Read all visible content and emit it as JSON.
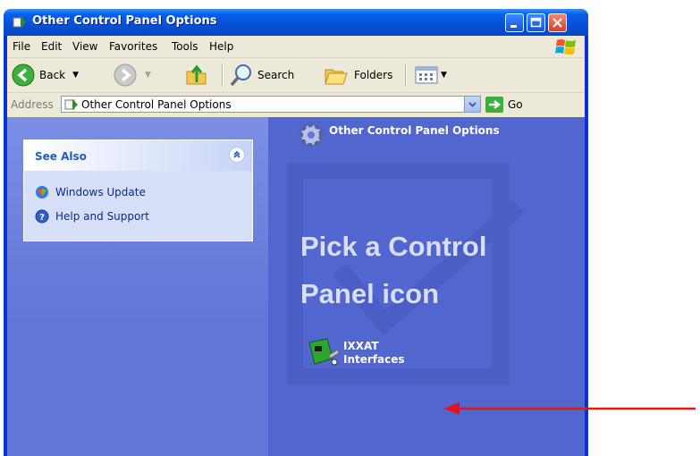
{
  "window": {
    "title": "Other Control Panel Options"
  },
  "menu": {
    "items": [
      "File",
      "Edit",
      "View",
      "Favorites",
      "Tools",
      "Help"
    ]
  },
  "toolbar": {
    "back": "Back",
    "search": "Search",
    "folders": "Folders"
  },
  "address": {
    "label": "Address",
    "value": "Other Control Panel Options",
    "go": "Go"
  },
  "see_also": {
    "title": "See Also",
    "links": [
      "Windows Update",
      "Help and Support"
    ]
  },
  "main": {
    "title": "Other Control Panel Options",
    "heading_line1": "Pick a Control",
    "heading_line2": "Panel icon",
    "icon_label_line1": "IXXAT",
    "icon_label_line2": "Interfaces"
  },
  "colors": {
    "titlebar": "#0a5fe8",
    "content": "#6375d6",
    "arrow": "#e0161c"
  }
}
